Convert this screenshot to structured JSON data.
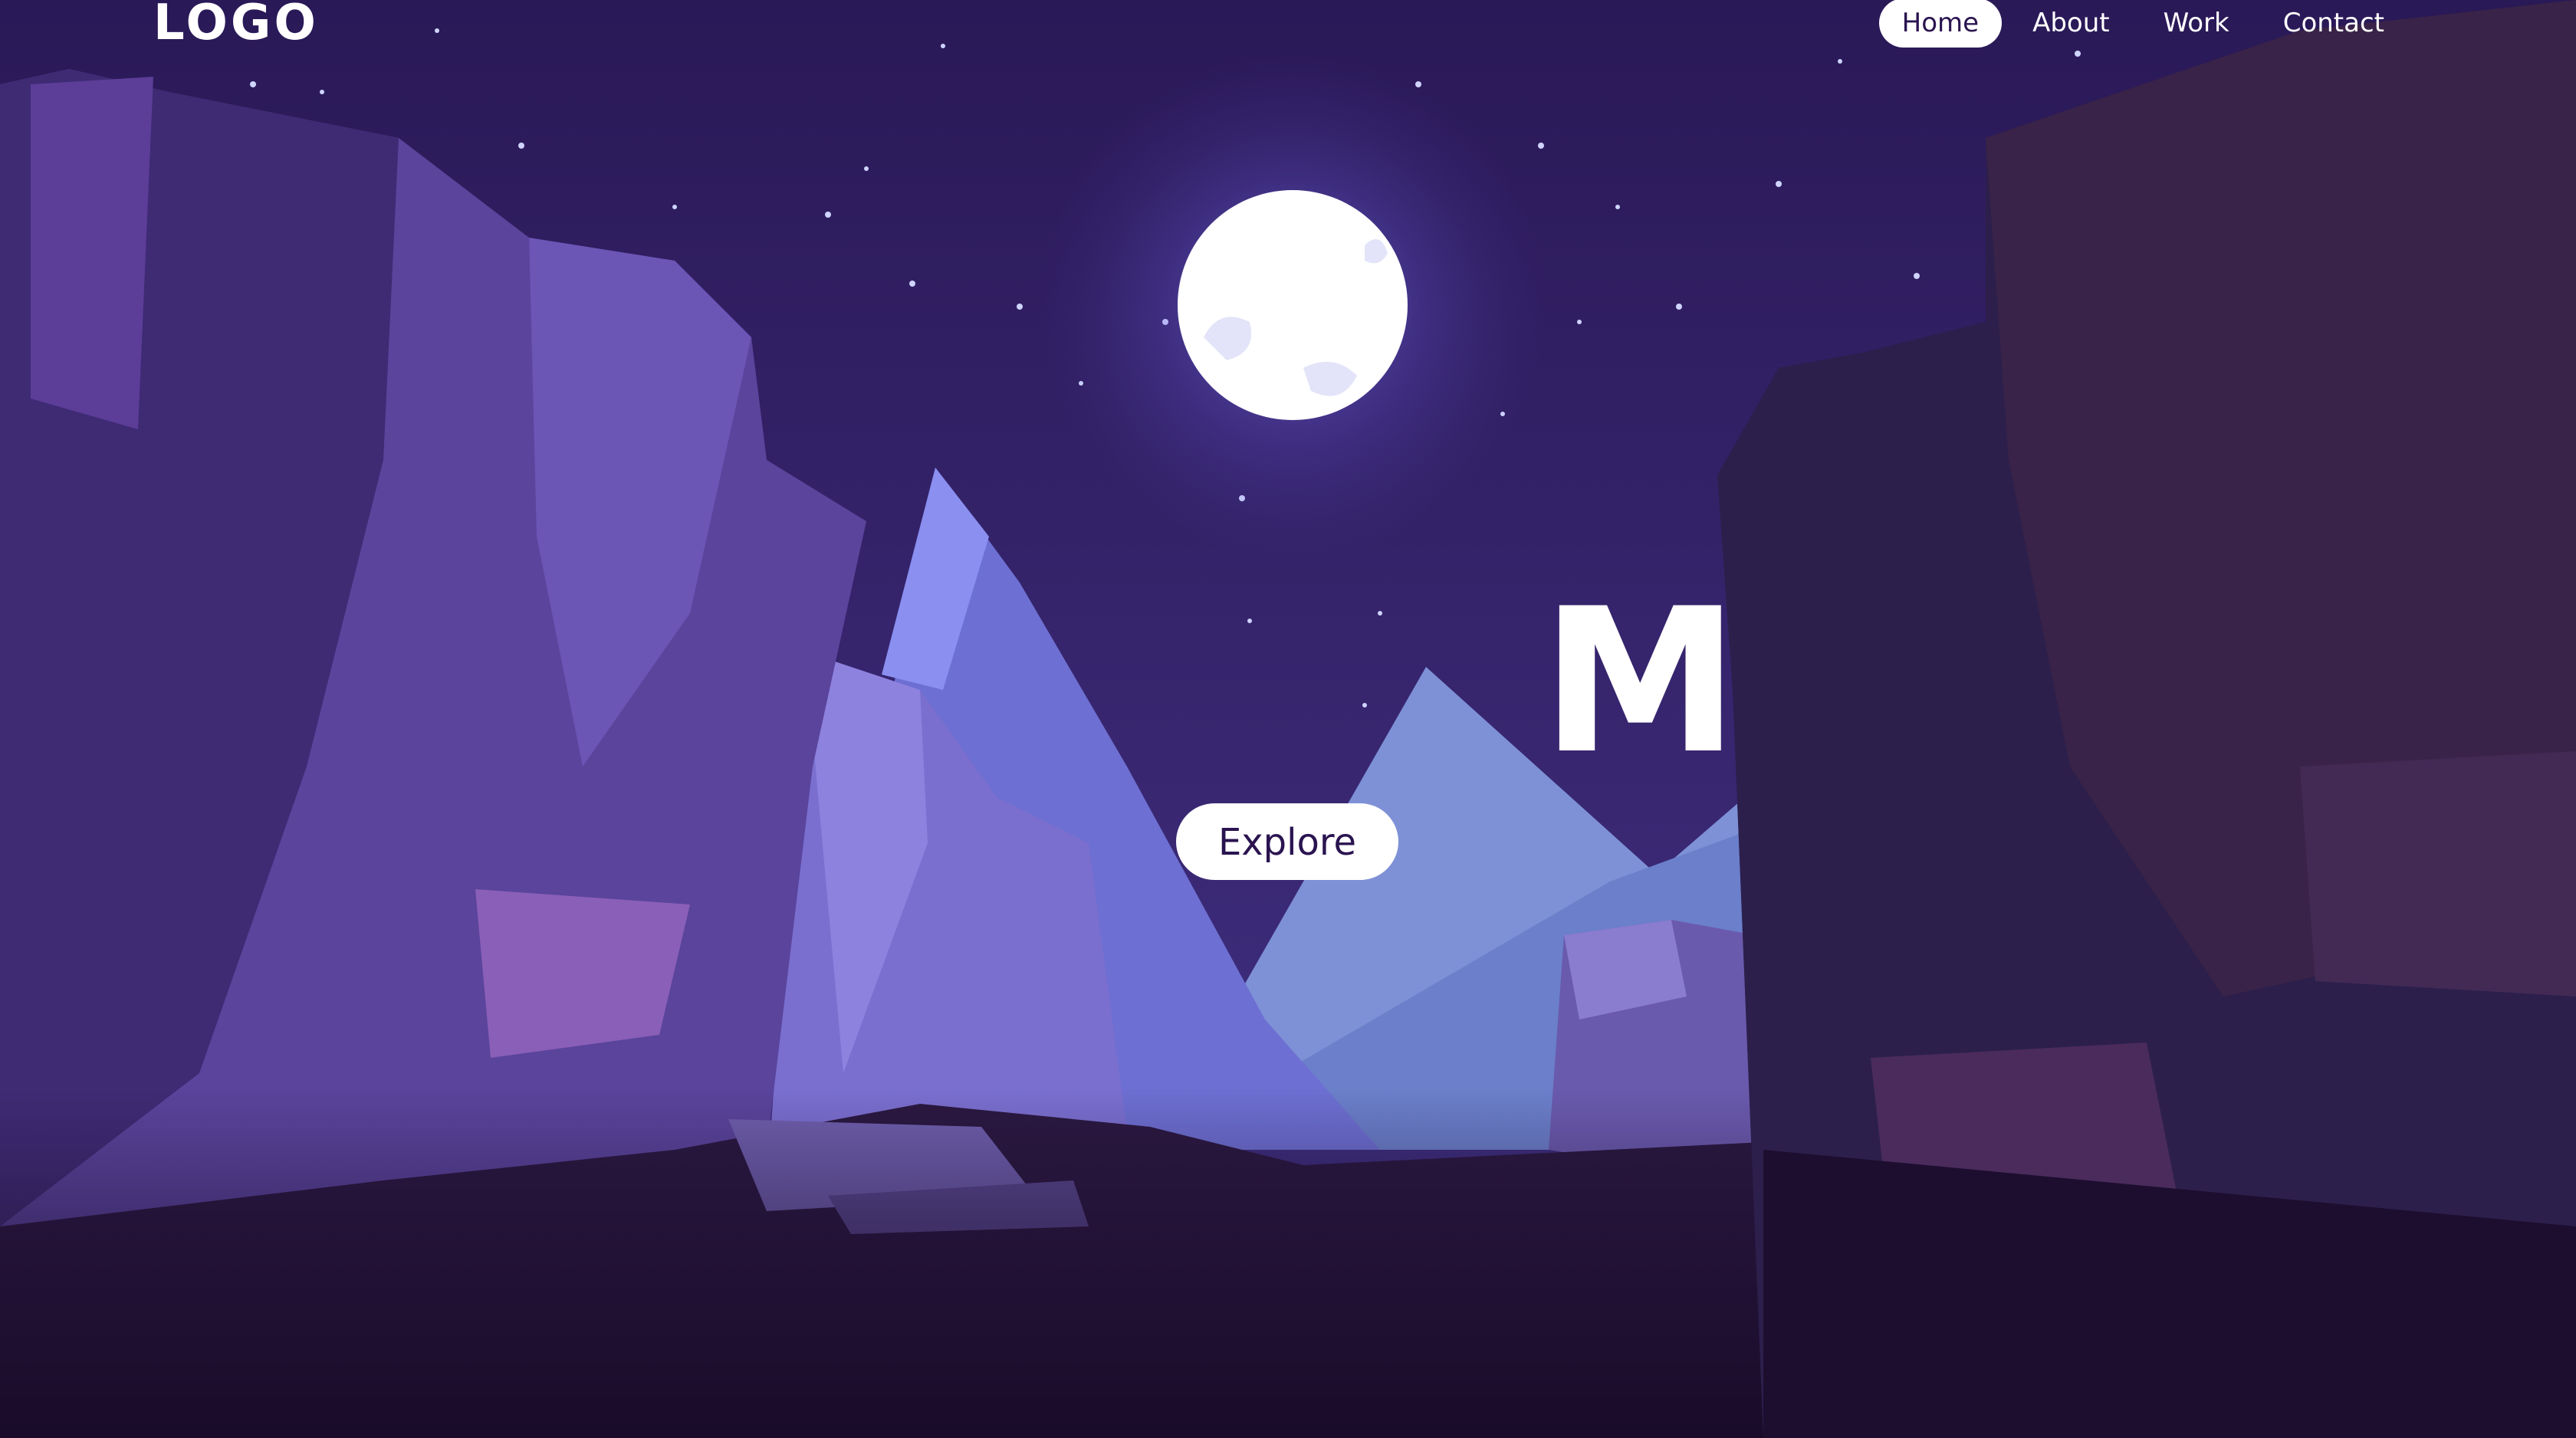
{
  "header": {
    "logo": "LOGO",
    "nav": [
      {
        "label": "Home",
        "active": true
      },
      {
        "label": "About",
        "active": false
      },
      {
        "label": "Work",
        "active": false
      },
      {
        "label": "Contact",
        "active": false
      }
    ]
  },
  "hero": {
    "title": "Mo",
    "cta_label": "Explore"
  },
  "colors": {
    "sky_top": "#2b1a5e",
    "sky_bottom": "#3d2a78",
    "moon": "#ffffff",
    "far_mountain": "#7d8fd6",
    "near_mountain": "#6a6fd0",
    "rock_left": "#4e3a8c",
    "rock_right": "#2a1a44",
    "ground": "#1a0b2a",
    "button_bg": "#ffffff",
    "button_text": "#2a1450"
  }
}
